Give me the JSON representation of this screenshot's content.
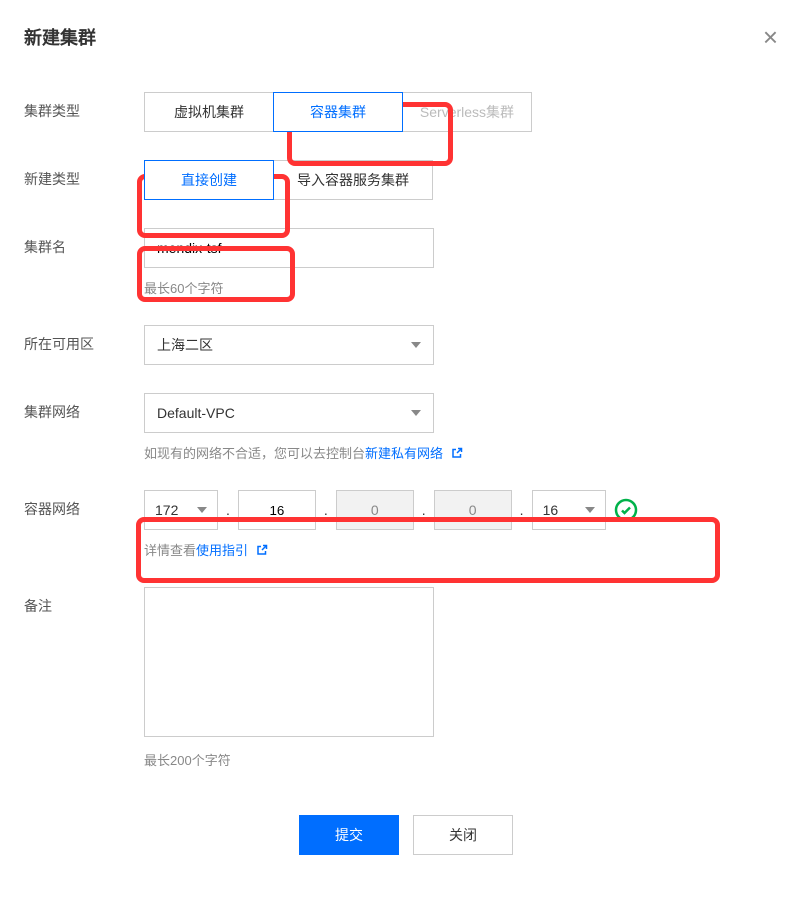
{
  "dialog": {
    "title": "新建集群"
  },
  "cluster_type": {
    "label": "集群类型",
    "options": [
      "虚拟机集群",
      "容器集群",
      "Serverless集群"
    ],
    "selected_index": 1,
    "disabled_index": 2
  },
  "create_type": {
    "label": "新建类型",
    "options": [
      "直接创建",
      "导入容器服务集群"
    ],
    "selected_index": 0
  },
  "cluster_name": {
    "label": "集群名",
    "value": "mendix-tsf",
    "hint": "最长60个字符"
  },
  "zone": {
    "label": "所在可用区",
    "value": "上海二区"
  },
  "network": {
    "label": "集群网络",
    "value": "Default-VPC",
    "hint_prefix": "如现有的网络不合适，您可以去控制台",
    "hint_link": "新建私有网络"
  },
  "container_network": {
    "label": "容器网络",
    "octet1": "172",
    "octet2": "16",
    "octet3": "0",
    "octet4": "0",
    "mask": "16",
    "hint_prefix": "详情查看",
    "hint_link": "使用指引"
  },
  "remark": {
    "label": "备注",
    "value": "",
    "hint": "最长200个字符"
  },
  "footer": {
    "submit": "提交",
    "close": "关闭"
  }
}
